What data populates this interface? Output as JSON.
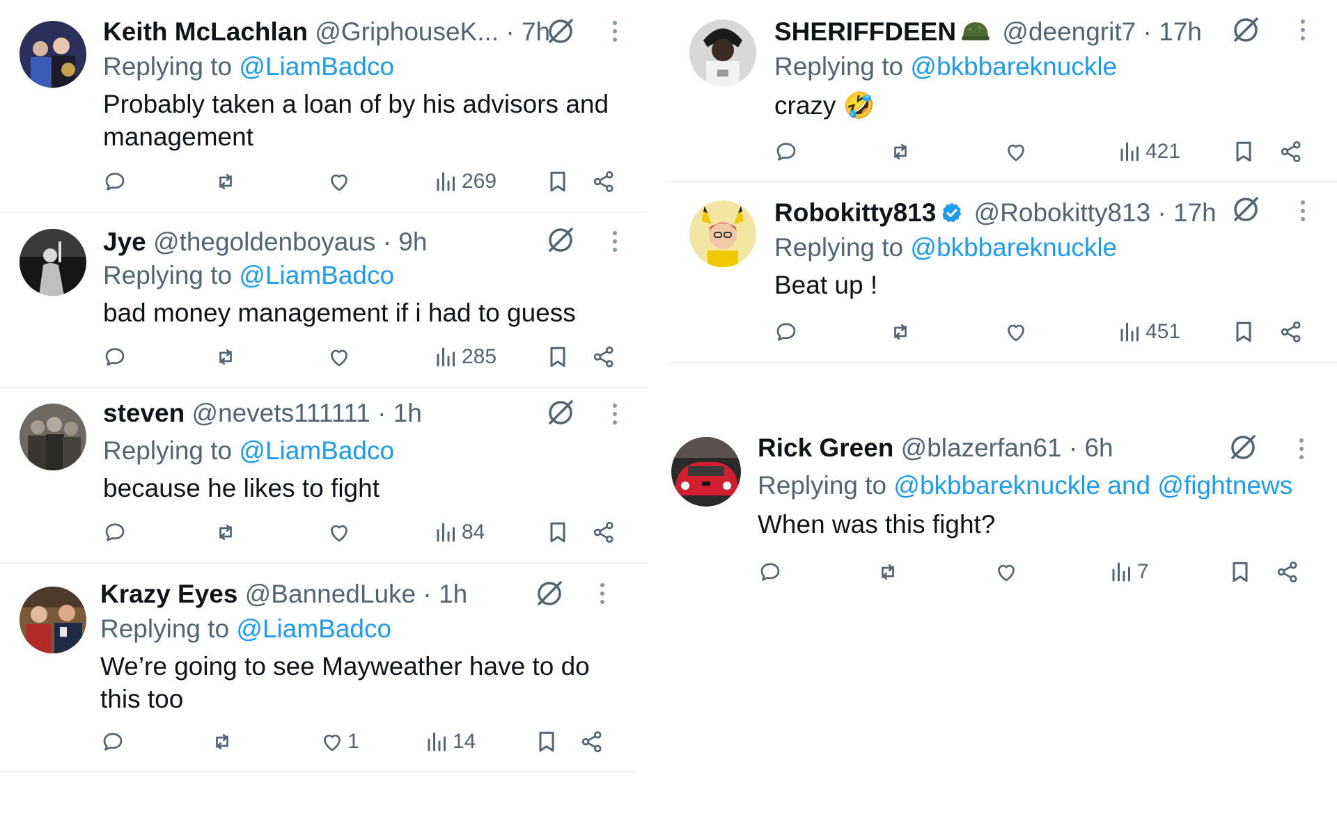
{
  "left_column": [
    {
      "name": "Keith McLachlan",
      "handle": "@GriphouseK... · 7h",
      "replying_prefix": "Replying to ",
      "replying_to": "@LiamBadco",
      "text": "Probably taken a loan of by his advisors and management",
      "views": "269",
      "likes": ""
    },
    {
      "name": "Jye",
      "handle": "@thegoldenboyaus · 9h",
      "replying_prefix": "Replying to ",
      "replying_to": "@LiamBadco",
      "text": "bad money management if i had to guess",
      "views": "285",
      "likes": ""
    },
    {
      "name": "steven",
      "handle": "@nevets111111 · 1h",
      "replying_prefix": "Replying to ",
      "replying_to": "@LiamBadco",
      "text": "because he likes to fight",
      "views": "84",
      "likes": ""
    },
    {
      "name": "Krazy Eyes",
      "handle": "@BannedLuke · 1h",
      "replying_prefix": "Replying to ",
      "replying_to": "@LiamBadco",
      "text": "We’re going to see Mayweather have to do this too",
      "views": "14",
      "likes": "1"
    }
  ],
  "right_column": [
    {
      "name": "SHERIFFDEEN",
      "handle": "@deengrit7 · 17h",
      "replying_prefix": "Replying to ",
      "replying_to": "@bkbbareknuckle",
      "text": "crazy 🤣",
      "views": "421",
      "likes": ""
    },
    {
      "name": "Robokitty813",
      "handle": "@Robokitty813 · 17h",
      "replying_prefix": "Replying to ",
      "replying_to": "@bkbbareknuckle",
      "text": "Beat up !",
      "views": "451",
      "likes": ""
    },
    {
      "name": "Rick Green",
      "handle": "@blazerfan61 · 6h",
      "replying_prefix": "Replying to ",
      "replying_to": "@bkbbareknuckle and @fightnews",
      "text": "When was this fight?",
      "views": "7",
      "likes": ""
    }
  ],
  "colors": {
    "link": "#1d9bf0",
    "secondary_text": "#536471",
    "primary_text": "#0f1419",
    "divider": "#eff3f4"
  },
  "icons": [
    "reply-icon",
    "retweet-icon",
    "like-icon",
    "views-icon",
    "bookmark-icon",
    "share-icon",
    "grok-icon",
    "more-icon",
    "verified-badge-icon",
    "helmet-emoji-icon"
  ]
}
